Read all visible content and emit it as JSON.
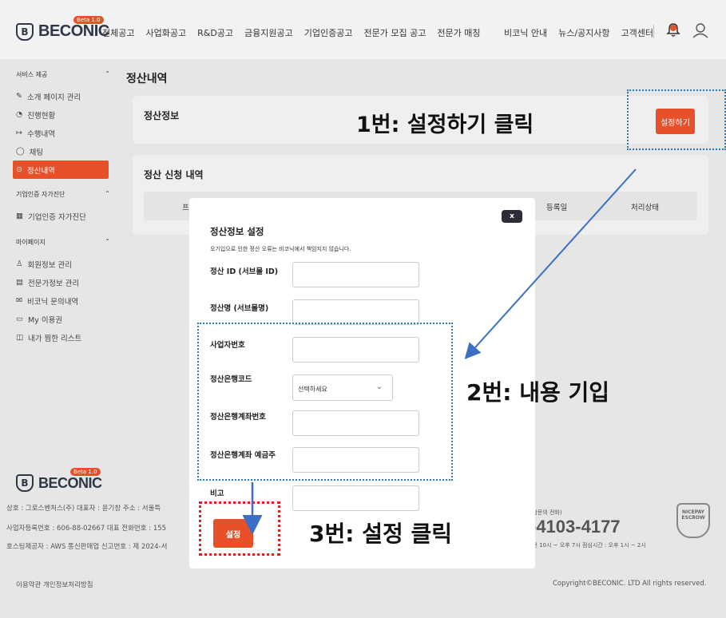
{
  "header": {
    "brand": "BECONIC",
    "beta": "Beta 1.0",
    "nav": [
      "전체공고",
      "사업화공고",
      "R&D공고",
      "금융지원공고",
      "기업인증공고",
      "전문가 모집 공고",
      "전문가 매칭"
    ],
    "nav_right": [
      "비코닉 안내",
      "뉴스/공지사항",
      "고객센터"
    ]
  },
  "sidebar": {
    "sections": [
      {
        "title": "서비스 제공",
        "items": [
          "소개 페이지 관리",
          "진행현황",
          "수행내역",
          "채팅",
          "정산내역"
        ]
      },
      {
        "title": "기업인증 자가진단",
        "items": [
          "기업인증 자가진단"
        ]
      },
      {
        "title": "마이페이지",
        "items": [
          "회원정보 관리",
          "전문가정보 관리",
          "비코닉 문의내역",
          "My 이용권",
          "내가 찜한 리스트"
        ]
      }
    ]
  },
  "main": {
    "title": "정산내역",
    "card1_title": "정산정보",
    "set_button": "설정하기",
    "card2_title": "정산 신청 내역",
    "table_headers": [
      "프",
      "등록일",
      "처리상태"
    ]
  },
  "footer": {
    "brand": "BECONIC",
    "line1": "상호 : 그로스벤처스(주)    대표자 : 윤기창    주소 : 서울특",
    "line2": "사업자등록번호 : 606-88-02667    대표 전화번호 : 155",
    "line3": "호스팅제공자 : AWS    통신판매업 신고번호 : 제 2024-서",
    "phone_note": "상담문의 전화)",
    "phone": "-4103-4177",
    "hours": "오전 10시 ~ 오후 7시  점심시간 : 오후 1시 ~ 2시",
    "escrow": "NICEPAY ESCROW",
    "links": "이용약관    개인정보처리방침",
    "copyright": "Copyright©BECONIC. LTD All rights reserved."
  },
  "modal": {
    "title": "정산정보 설정",
    "subtitle": "오기입으로 인한 정산 오류는 비코닉에서 책임지지 않습니다.",
    "close": "x",
    "fields": [
      "정산 ID (서브몰 ID)",
      "정산명 (서브몰명)",
      "사업자번호",
      "정산은행코드",
      "정산은행계좌번호",
      "정산은행계좌 예금주",
      "비고"
    ],
    "select_placeholder": "선택하세요",
    "submit": "설정"
  },
  "annotations": {
    "step1": "1번: 설정하기 클릭",
    "step2": "2번: 내용 기입",
    "step3": "3번: 설정 클릭"
  },
  "colors": {
    "accent": "#e8502a",
    "annotation_blue": "#2a7ab8",
    "annotation_red": "#e02020"
  }
}
